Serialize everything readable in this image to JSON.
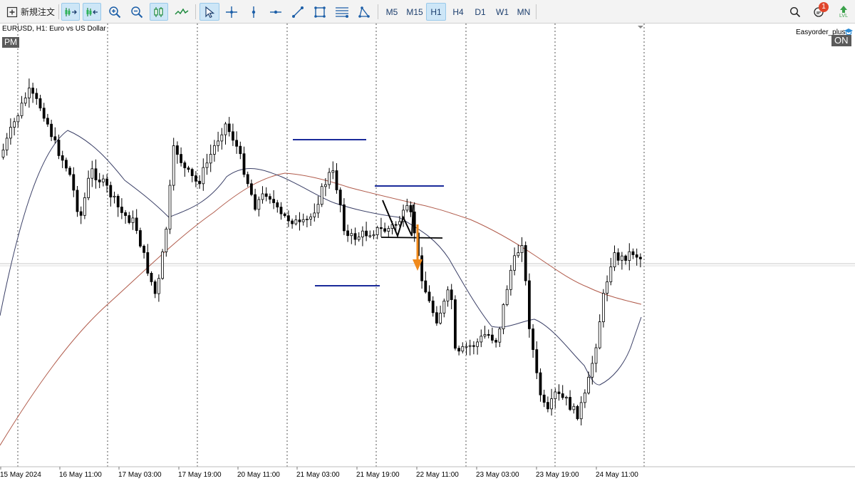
{
  "toolbar": {
    "new_order_label": "新規注文",
    "timeframes": [
      {
        "label": "M5",
        "active": false
      },
      {
        "label": "M15",
        "active": false
      },
      {
        "label": "H1",
        "active": true
      },
      {
        "label": "H4",
        "active": false
      },
      {
        "label": "D1",
        "active": false
      },
      {
        "label": "W1",
        "active": false
      },
      {
        "label": "MN",
        "active": false
      }
    ],
    "notification_count": "1",
    "signal_label": "LVL"
  },
  "chart": {
    "symbol_info": "EURUSD, H1:  Euro vs US Dollar",
    "session_badge": "PM",
    "indicator_name": "Easyorder_plus",
    "indicator_state": "ON",
    "time_labels": [
      "15 May 2024",
      "16 May 11:00",
      "17 May 03:00",
      "17 May 19:00",
      "20 May 11:00",
      "21 May 03:00",
      "21 May 19:00",
      "22 May 11:00",
      "23 May 03:00",
      "23 May 19:00",
      "24 May 11:00"
    ],
    "colors": {
      "candle": "#000000",
      "ma_fast": "#3a3f66",
      "ma_slow": "#b05a4a",
      "level_lines": "#1a2a9a",
      "arrow": "#f08a1c",
      "grid": "#555555"
    }
  }
}
